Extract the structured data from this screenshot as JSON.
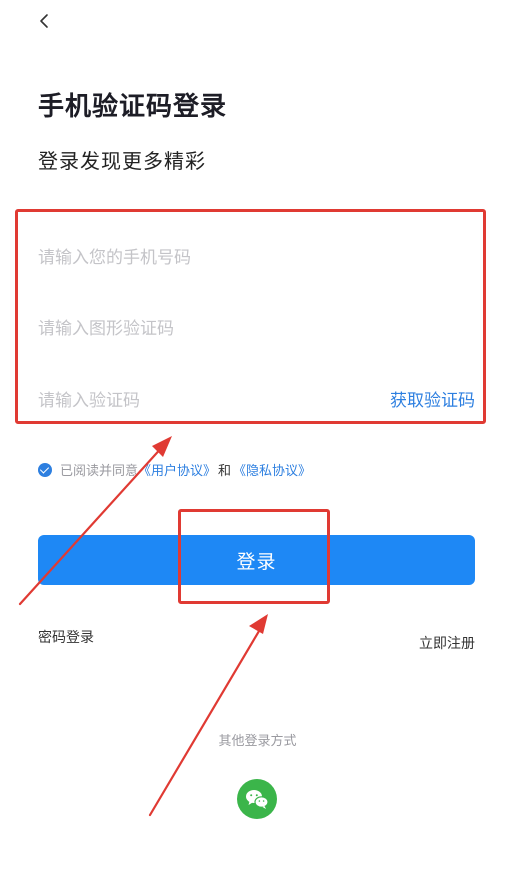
{
  "header": {
    "back_icon": "chevron-left-icon"
  },
  "title": "手机验证码登录",
  "subtitle": "登录发现更多精彩",
  "form": {
    "phone_placeholder": "请输入您的手机号码",
    "captcha_placeholder": "请输入图形验证码",
    "code_placeholder": "请输入验证码",
    "get_code_label": "获取验证码"
  },
  "agreement": {
    "checked": true,
    "prefix": "已阅读并同意",
    "user_agreement": "《用户协议》",
    "and": "和",
    "privacy_policy": "《隐私协议》"
  },
  "login_button": "登录",
  "password_login": "密码登录",
  "register": "立即注册",
  "other_login_methods": "其他登录方式",
  "wechat_icon": "wechat-icon",
  "colors": {
    "accent": "#1e88f5",
    "link": "#2d7fe0",
    "annotation": "#e03a33",
    "wechat": "#3bb54a"
  }
}
